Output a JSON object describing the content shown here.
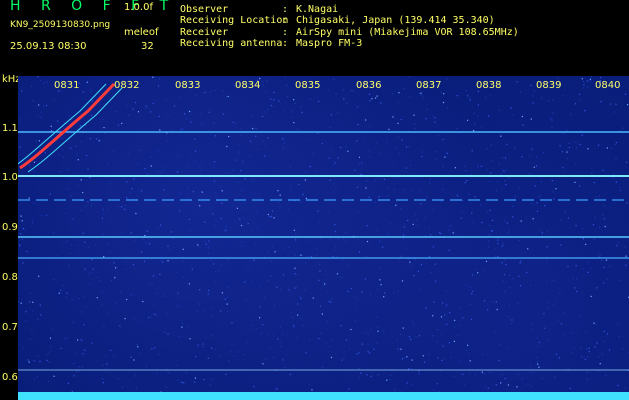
{
  "header": {
    "app_title": "H R O F F T",
    "version": "1.0.0f",
    "filename": "KN9_2509130830.png",
    "meleof_label": "meleof",
    "datetime": "25.09.13 08:30",
    "meleof_value": "32",
    "meta": [
      {
        "key": "Observer",
        "value": "K.Nagai"
      },
      {
        "key": "Receiving Location",
        "value": "Chigasaki, Japan (139.414 35.340)"
      },
      {
        "key": "Receiver",
        "value": "AirSpy mini (Miakejima VOR 108.65MHz)"
      },
      {
        "key": "Receiving antenna",
        "value": "Maspro FM-3"
      }
    ],
    "colon": ":"
  },
  "plot": {
    "y_unit": "kHz",
    "y_ticks": [
      "1.1",
      "1.0",
      "0.9",
      "0.8",
      "0.7",
      "0.6"
    ],
    "x_ticks": [
      "0831",
      "0832",
      "0833",
      "0834",
      "0835",
      "0836",
      "0837",
      "0838",
      "0839",
      "0840"
    ],
    "colors": {
      "background": "#081c78",
      "carrier": "#40c8ff",
      "echo": "#ff4040",
      "text": "#ffff66",
      "title": "#00ff66"
    }
  }
}
